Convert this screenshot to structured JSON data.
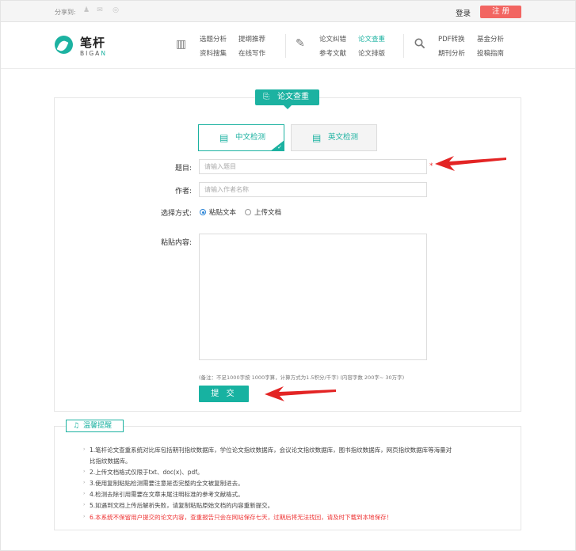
{
  "topbar": {
    "share_label": "分享到:",
    "share_icons": [
      "qq-icon",
      "wechat-icon",
      "weibo-icon"
    ],
    "login": "登录",
    "register": "注 册"
  },
  "logo": {
    "cn": "笔杆",
    "en_prefix": "BIGA",
    "en_suffix": "N"
  },
  "nav": {
    "group1": {
      "icon": "books-icon",
      "links": [
        "选题分析",
        "提纲推荐",
        "资料搜集",
        "在线写作"
      ]
    },
    "group2": {
      "icon": "pen-icon",
      "links": [
        "论文纠错",
        "论文查重",
        "参考文献",
        "论文排版"
      ],
      "active": "论文查重"
    },
    "group3": {
      "icon": "search-icon",
      "links": [
        "PDF转换",
        "基金分析",
        "期刊分析",
        "投稿指南"
      ]
    }
  },
  "form": {
    "title": "论文查重",
    "tabs": [
      {
        "label": "中文检测",
        "active": true
      },
      {
        "label": "英文检测",
        "active": false
      }
    ],
    "title_label": "题目:",
    "title_placeholder": "请输入题目",
    "author_label": "作者:",
    "author_placeholder": "请输入作者名称",
    "mode_label": "选择方式:",
    "mode_options": [
      {
        "label": "粘贴文本",
        "selected": true
      },
      {
        "label": "上传文档",
        "selected": false
      }
    ],
    "content_label": "粘贴内容:",
    "note": "(备注：不足1000字按 1000字算，计算方式为1.5积分/千字)        (内容字数 200字~ 30万字)",
    "submit": "提 交"
  },
  "notice": {
    "title": "温馨提醒",
    "lines": [
      "1.笔杆论文查重系统对比库包括期刊指纹数据库，学位论文指纹数据库，会议论文指纹数据库，图书指纹数据库，网页指纹数据库等海量对",
      "比指纹数据库。",
      "2.上传文档格式仅限于txt、doc(x)、pdf。",
      "3.使用复制粘贴检测需要注意是否完整的全文被复制进去。",
      "4.检测去除引用需要在文章末尾注明标准的参考文献格式。",
      "5.如遇到文档上传后解析失败，请复制粘贴原始文档的内容重新提交。",
      "6.本系统不保留用户提交的论文内容，查重报告只会在网站保存七天，过期后将无法找回，请及时下载到本地保存！"
    ]
  },
  "colors": {
    "accent": "#1cb2a1",
    "register": "#f26561",
    "warning": "#e33333",
    "arrow": "#e32424"
  }
}
